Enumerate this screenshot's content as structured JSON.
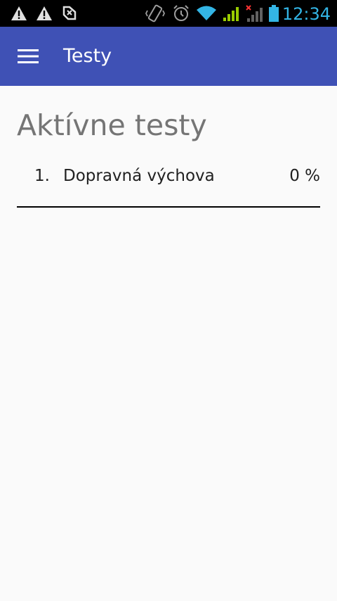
{
  "status_bar": {
    "time": "12:34",
    "icons": [
      "warning-icon",
      "warning-icon",
      "developer-icon",
      "vibrate-icon",
      "alarm-icon",
      "wifi-icon",
      "signal-icon",
      "signal-no-service-icon",
      "battery-icon"
    ],
    "clock_color": "#33b5e5"
  },
  "app_bar": {
    "title": "Testy",
    "color": "#3f51b5",
    "menu_icon": "hamburger-menu-icon"
  },
  "main": {
    "section_title": "Aktívne testy",
    "tests": [
      {
        "index": "1.",
        "name": "Dopravná výchova",
        "progress": "0 %"
      }
    ]
  }
}
